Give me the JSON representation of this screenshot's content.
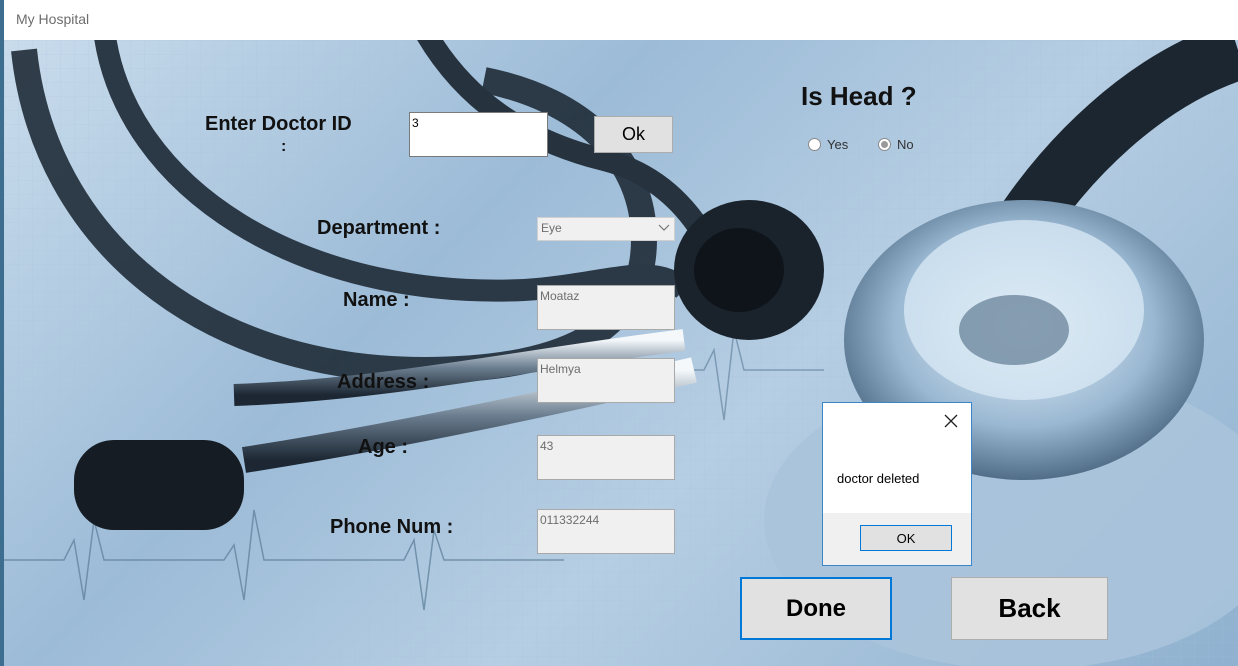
{
  "window": {
    "title": "My Hospital"
  },
  "form": {
    "doctor_id_label": "Enter Doctor ID",
    "doctor_id_colon": ":",
    "doctor_id_value": "3",
    "ok_label": "Ok",
    "is_head_label": "Is Head ?",
    "yes_label": "Yes",
    "no_label": "No",
    "is_head_selected": "No",
    "department_label": "Department :",
    "department_value": "Eye",
    "name_label": "Name :",
    "name_value": "Moataz",
    "address_label": "Address :",
    "address_value": "Helmya",
    "age_label": "Age :",
    "age_value": "43",
    "phone_label": "Phone Num :",
    "phone_value": "011332244",
    "done_label": "Done",
    "back_label": "Back"
  },
  "dialog": {
    "message": "doctor deleted",
    "ok_label": "OK"
  },
  "icons": [
    "close-icon",
    "chevron-down-icon"
  ],
  "colors": {
    "dialog_border": "#3a86c8",
    "button_face": "#e1e1e1",
    "focus_border": "#0078d7"
  }
}
